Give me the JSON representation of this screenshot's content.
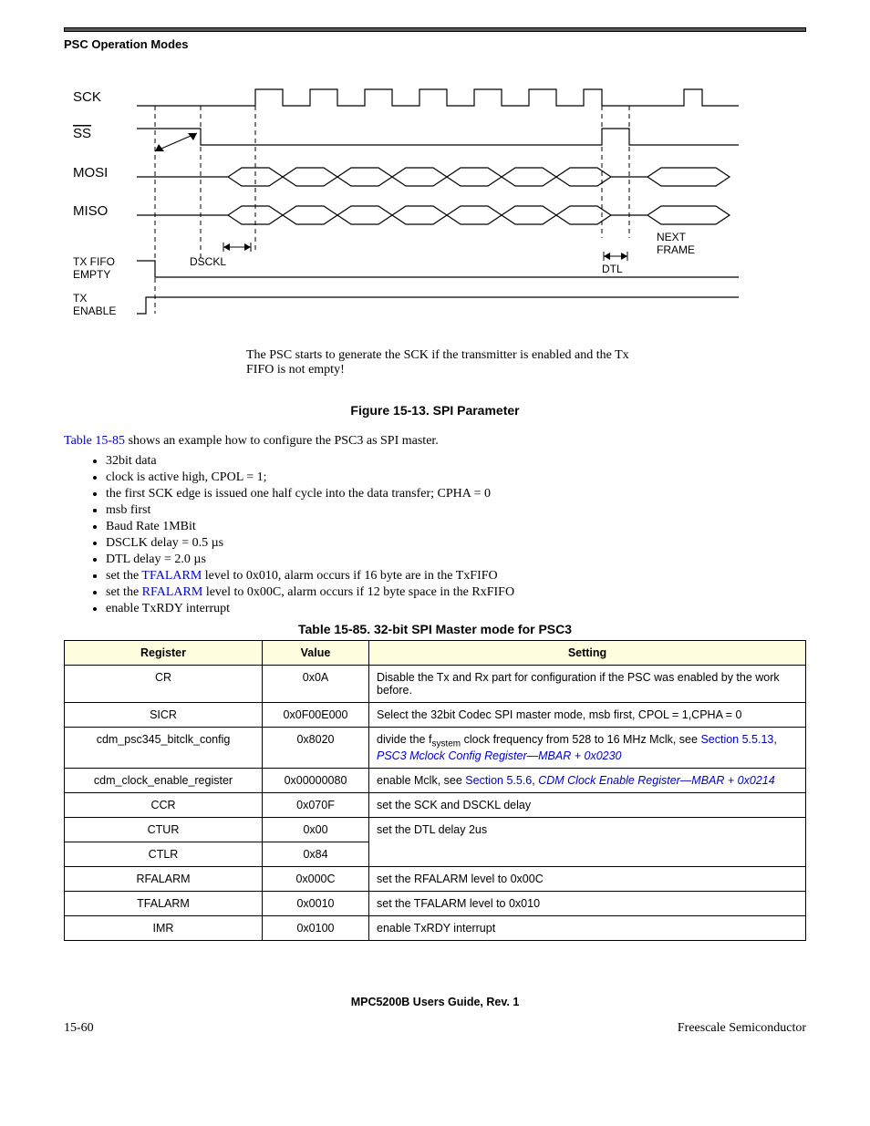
{
  "header": {
    "section": "PSC Operation Modes"
  },
  "diagram": {
    "labels": {
      "sck": "SCK",
      "ss": "SS",
      "mosi": "MOSI",
      "miso": "MISO",
      "txfifo": "TX FIFO",
      "empty": "EMPTY",
      "txenable": "TX",
      "enable": "ENABLE",
      "dsckl": "DSCKL",
      "dtl": "DTL",
      "next": "NEXT",
      "frame": "FRAME"
    },
    "caption": "The PSC starts to generate the SCK if the transmitter is enabled and the Tx FIFO is not empty!"
  },
  "figure_caption": "Figure 15-13. SPI Parameter",
  "intro": {
    "ref": "Table 15-85",
    "tail": " shows an example how to configure the PSC3 as SPI master."
  },
  "bullets": [
    {
      "text": "32bit data"
    },
    {
      "text": "clock is active high, CPOL = 1;"
    },
    {
      "text": "the first SCK edge is issued one half cycle into the data transfer; CPHA = 0"
    },
    {
      "text": "msb first"
    },
    {
      "text": "Baud Rate 1MBit"
    },
    {
      "text": "DSCLK delay = 0.5 µs"
    },
    {
      "text": "DTL delay = 2.0 µs"
    },
    {
      "pre": "set the ",
      "link": "TFALARM",
      "post": " level to 0x010, alarm occurs if 16 byte are in the TxFIFO"
    },
    {
      "pre": "set the ",
      "link": "RFALARM",
      "post": " level to 0x00C, alarm occurs if 12 byte space in the RxFIFO"
    },
    {
      "text": "enable TxRDY interrupt"
    }
  ],
  "table_caption": "Table 15-85. 32-bit SPI Master mode for PSC3",
  "table": {
    "headers": {
      "c1": "Register",
      "c2": "Value",
      "c3": "Setting"
    },
    "rows": [
      {
        "reg": "CR",
        "val": "0x0A",
        "setting_plain": "Disable the Tx and Rx part for configuration if the PSC was enabled by the work before."
      },
      {
        "reg": "SICR",
        "val": "0x0F00E000",
        "setting_plain": "Select the 32bit Codec SPI master mode, msb first, CPOL = 1,CPHA = 0"
      },
      {
        "reg": "cdm_psc345_bitclk_config",
        "val": "0x8020",
        "setting_pre": "divide the f",
        "setting_sub": "system",
        "setting_mid": " clock frequency from 528 to 16 MHz Mclk, see ",
        "setting_link1": "Section 5.5.13",
        "setting_link_sep": ", ",
        "setting_link2": "PSC3 Mclock Config Register—MBAR + 0x0230"
      },
      {
        "reg": "cdm_clock_enable_register",
        "val": "0x00000080",
        "setting_pre": "enable Mclk, see ",
        "setting_link1": "Section 5.5.6",
        "setting_link_sep": ", ",
        "setting_link2": "CDM Clock Enable Register—MBAR + 0x0214"
      },
      {
        "reg": "CCR",
        "val": "0x070F",
        "setting_plain": "set the SCK and DSCKL delay"
      },
      {
        "reg": "CTUR",
        "val": "0x00",
        "setting_plain": "set the DTL delay 2us",
        "rowspan": 2
      },
      {
        "reg": "CTLR",
        "val": "0x84",
        "merged": true
      },
      {
        "reg": "RFALARM",
        "val": "0x000C",
        "setting_plain": "set the RFALARM level to 0x00C"
      },
      {
        "reg": "TFALARM",
        "val": "0x0010",
        "setting_plain": "set the TFALARM level to 0x010"
      },
      {
        "reg": "IMR",
        "val": "0x0100",
        "setting_plain": "enable TxRDY interrupt"
      }
    ]
  },
  "footer": {
    "center": "MPC5200B Users Guide, Rev. 1",
    "left": "15-60",
    "right": "Freescale Semiconductor"
  }
}
